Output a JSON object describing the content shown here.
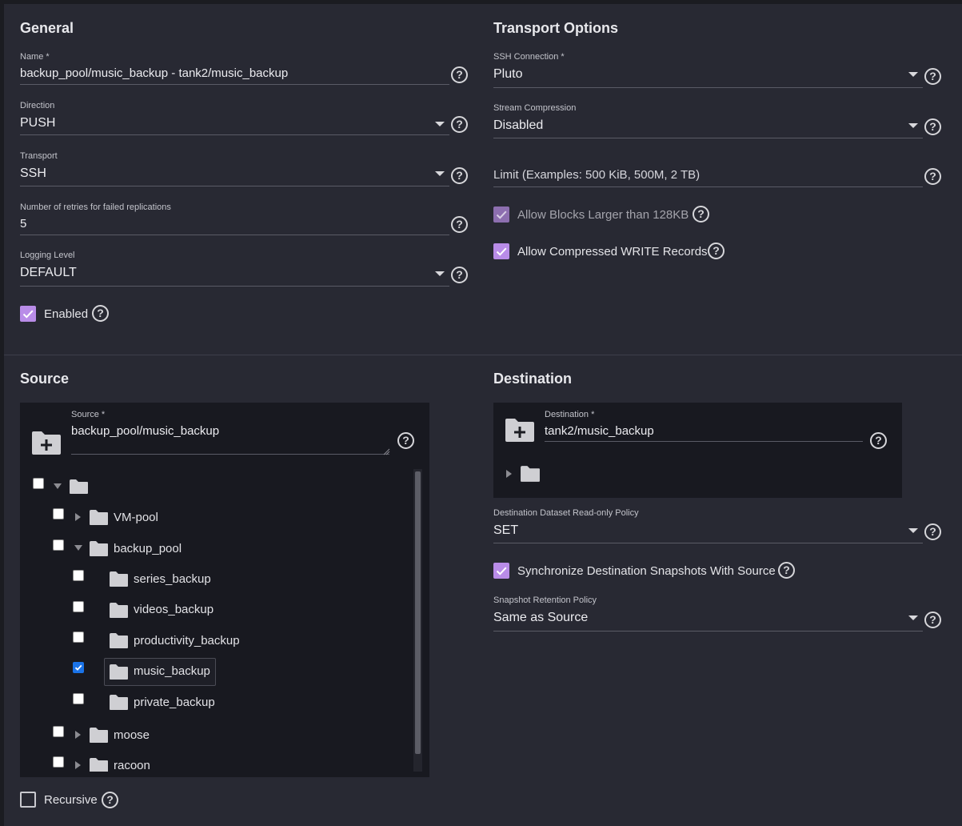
{
  "general": {
    "title": "General",
    "name": {
      "label": "Name *",
      "value": "backup_pool/music_backup - tank2/music_backup"
    },
    "direction": {
      "label": "Direction",
      "value": "PUSH"
    },
    "transport": {
      "label": "Transport",
      "value": "SSH"
    },
    "retries": {
      "label": "Number of retries for failed replications",
      "value": "5"
    },
    "logging": {
      "label": "Logging Level",
      "value": "DEFAULT"
    },
    "enabled": {
      "label": "Enabled",
      "checked": true
    }
  },
  "transport_options": {
    "title": "Transport Options",
    "ssh_connection": {
      "label": "SSH Connection *",
      "value": "Pluto"
    },
    "stream_compression": {
      "label": "Stream Compression",
      "value": "Disabled"
    },
    "limit": {
      "placeholder": "Limit (Examples: 500 KiB, 500M, 2 TB)"
    },
    "allow_blocks": {
      "label": "Allow Blocks Larger than 128KB",
      "checked": true,
      "disabled": true
    },
    "allow_compressed": {
      "label": "Allow Compressed WRITE Records",
      "checked": true
    }
  },
  "source": {
    "title": "Source",
    "field": {
      "label": "Source *",
      "value": "backup_pool/music_backup"
    },
    "tree": {
      "root": {
        "label": "",
        "expanded": true,
        "checked": false
      },
      "items": [
        {
          "label": "VM-pool",
          "level": 1,
          "expandable": true,
          "expanded": false,
          "checked": false
        },
        {
          "label": "backup_pool",
          "level": 1,
          "expandable": true,
          "expanded": true,
          "checked": false
        },
        {
          "label": "series_backup",
          "level": 2,
          "expandable": false,
          "checked": false
        },
        {
          "label": "videos_backup",
          "level": 2,
          "expandable": false,
          "checked": false
        },
        {
          "label": "productivity_backup",
          "level": 2,
          "expandable": false,
          "checked": false
        },
        {
          "label": "music_backup",
          "level": 2,
          "expandable": false,
          "checked": true,
          "selected": true
        },
        {
          "label": "private_backup",
          "level": 2,
          "expandable": false,
          "checked": false
        },
        {
          "label": "moose",
          "level": 1,
          "expandable": true,
          "expanded": false,
          "checked": false
        },
        {
          "label": "racoon",
          "level": 1,
          "expandable": true,
          "expanded": false,
          "checked": false
        }
      ]
    },
    "recursive": {
      "label": "Recursive",
      "checked": false
    }
  },
  "destination": {
    "title": "Destination",
    "field": {
      "label": "Destination *",
      "value": "tank2/music_backup"
    },
    "readonly_policy": {
      "label": "Destination Dataset Read-only Policy",
      "value": "SET"
    },
    "sync_snapshots": {
      "label": "Synchronize Destination Snapshots With Source",
      "checked": true
    },
    "retention_policy": {
      "label": "Snapshot Retention Policy",
      "value": "Same as Source"
    }
  },
  "icons": {
    "help": "?",
    "check": "checkmark-icon",
    "folder": "folder-icon",
    "folder_add": "folder-plus-icon"
  },
  "colors": {
    "background": "#1b1c21",
    "card": "#282933",
    "accent": "#b98ce8",
    "tree_checkbox": "#1a73e8"
  }
}
